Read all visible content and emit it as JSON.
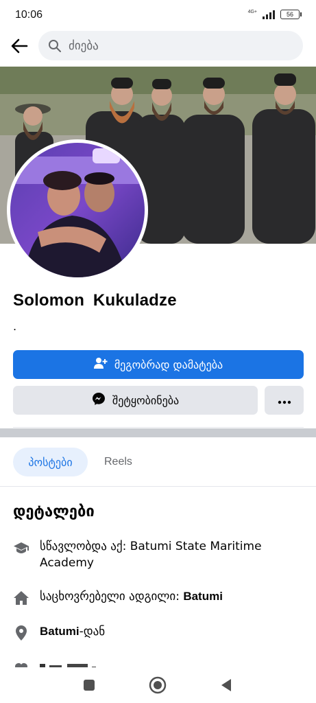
{
  "status_bar": {
    "time": "10:06",
    "network": "4G+",
    "battery": "56"
  },
  "search": {
    "placeholder": "ძიება"
  },
  "profile": {
    "name": "Solomon  Kukuladze",
    "bio": "."
  },
  "actions": {
    "add_friend": "მეგობრად დამატება",
    "message": "შეტყობინება"
  },
  "tabs": [
    {
      "label": "პოსტები",
      "active": true
    },
    {
      "label": "Reels",
      "active": false
    }
  ],
  "details": {
    "title": "დეტალები",
    "studied_prefix": "სწავლობდა აქ: ",
    "studied_value": "Batumi State Maritime Academy",
    "lives_prefix": "საცხოვრებელი ადგილი: ",
    "lives_value": "Batumi",
    "from_value": "Batumi",
    "from_suffix": "-დან"
  },
  "colors": {
    "primary": "#1b74e4",
    "button_gray": "#e4e6eb",
    "text": "#050505",
    "secondary_text": "#65676b"
  },
  "icons": [
    "back-arrow-icon",
    "search-icon",
    "add-friend-icon",
    "messenger-icon",
    "more-icon",
    "graduation-cap-icon",
    "home-icon",
    "location-pin-icon",
    "heart-icon",
    "nav-square-icon",
    "nav-home-icon",
    "nav-back-icon"
  ]
}
